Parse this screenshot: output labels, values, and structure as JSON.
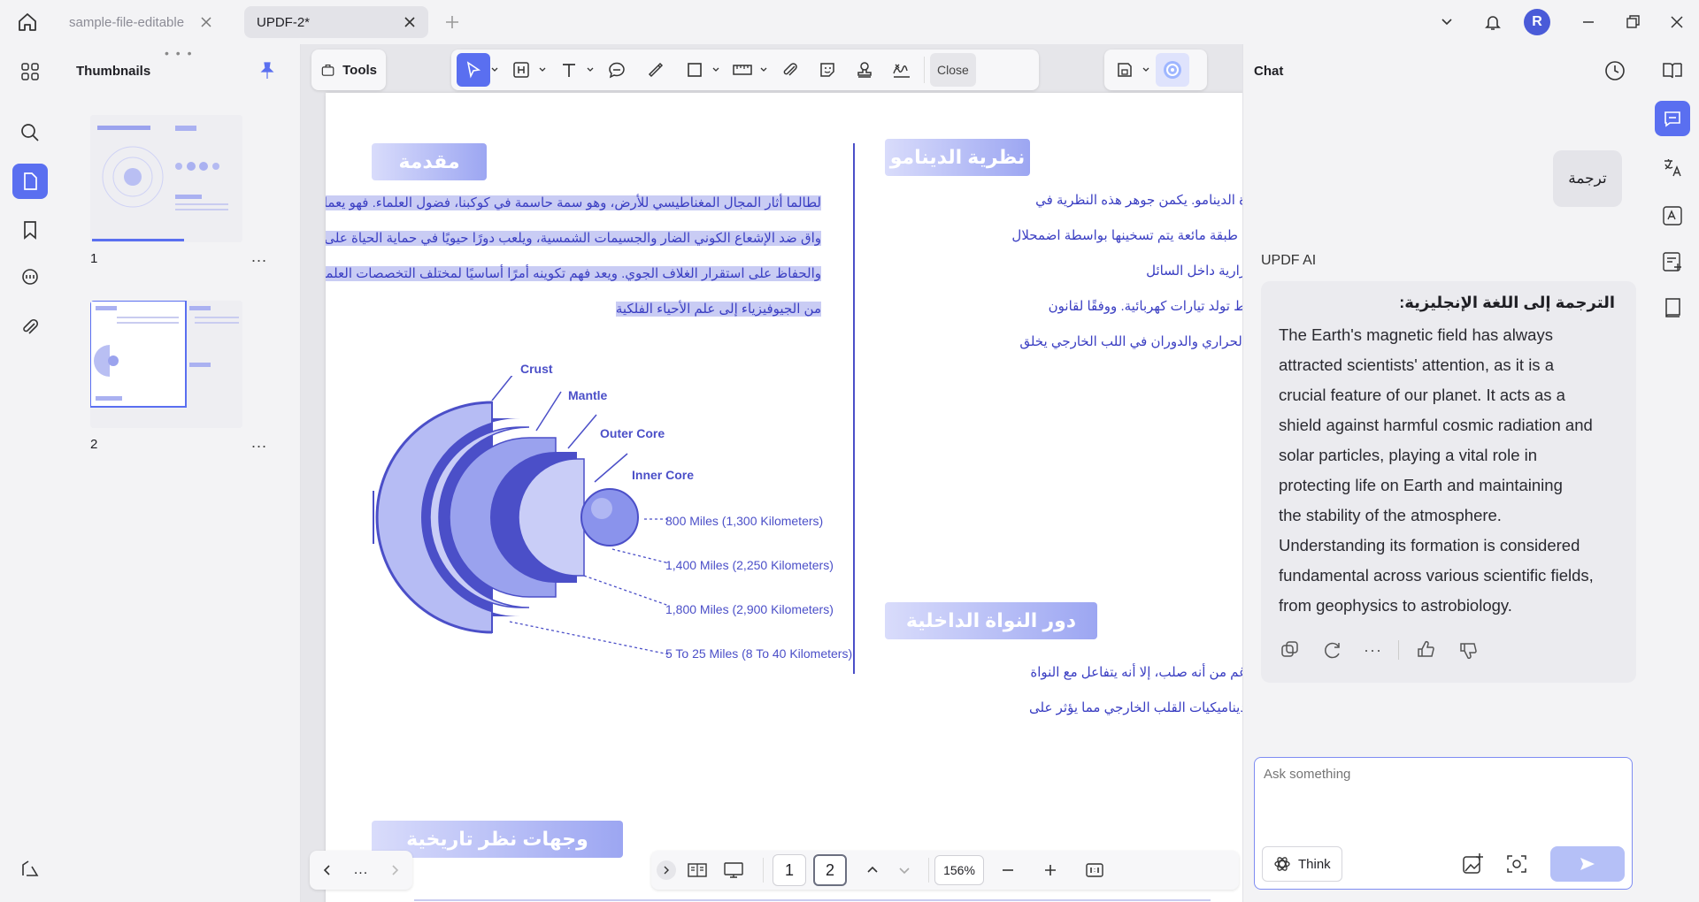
{
  "tabs": [
    {
      "label": "sample-file-editable",
      "active": false
    },
    {
      "label": "UPDF-2*",
      "active": true
    }
  ],
  "user": {
    "avatar_initial": "R",
    "avatar_color": "#4a5bd8"
  },
  "accent_color": "#5a6ff0",
  "thumbnails": {
    "title": "Thumbnails",
    "pages": [
      {
        "number": "1",
        "more": "..."
      },
      {
        "number": "2",
        "more": "..."
      }
    ]
  },
  "toolbar": {
    "tools_label": "Tools",
    "close_label": "Close"
  },
  "document": {
    "intro": {
      "heading": "مقدمة",
      "lines": [
        "لطالما أثار المجال المغناطيسي للأرض، وهو سمة حاسمة في كوكبنا، فضول العلماء. فهو يعمل كدرع",
        "واق ضد الإشعاع الكوني الضار والجسيمات الشمسية، ويلعب دورًا حيويًا في حماية الحياة على الأرض",
        "والحفاظ على استقرار الغلاف الجوي. ويعد فهم تكوينه أمرًا أساسيًا لمختلف التخصصات العلمية، بدءًا",
        "من الجيوفيزياء إلى علم الأحياء الفلكية"
      ]
    },
    "dynamo": {
      "heading": "نظرية الدينامو",
      "lines": [
        "ة الدينامو. يكمن جوهر هذه النظرية في",
        "، طبقة مائعة يتم تسخينها بواسطة اضمحلال",
        "رارية داخل السائل",
        "ط تولد تيارات كهربائية. ووفقًا لقانون",
        "الحراري والدوران في اللب الخارجي يخلق"
      ]
    },
    "inner_core": {
      "heading": "دور النواة الداخلية",
      "lines": [
        "غم من أنه صلب، إلا أنه يتفاعل مع النواة",
        "ديناميكيات القلب الخارجي مما يؤثر على"
      ]
    },
    "history": {
      "heading": "وجهات نظر تاريخية"
    },
    "diagram": {
      "layers": [
        "Crust",
        "Mantle",
        "Outer Core",
        "Inner Core"
      ],
      "distances": [
        "800 Miles (1,300 Kilometers)",
        "1,400 Miles (2,250 Kilometers)",
        "1,800 Miles (2,900 Kilometers)",
        "5 To 25 Miles (8 To 40 Kilometers)"
      ]
    }
  },
  "bottom_nav": {
    "more": "...",
    "pages": [
      "1",
      "2"
    ],
    "current_page": "2",
    "zoom": "156%"
  },
  "chat": {
    "title": "Chat",
    "user_message": "ترجمة",
    "assistant_name": "UPDF AI",
    "response_heading": "الترجمة إلى اللغة الإنجليزية:",
    "response_lines": [
      "The Earth's magnetic field has always",
      "attracted scientists' attention, as it is a",
      "crucial feature of our planet. It acts as a",
      "shield against harmful cosmic radiation and",
      "solar particles, playing a vital role in",
      "protecting life on Earth and maintaining",
      "the stability of the atmosphere.",
      "Understanding its formation is considered",
      "fundamental across various scientific fields,",
      "from geophysics to astrobiology."
    ],
    "input_placeholder": "Ask something",
    "think_label": "Think"
  }
}
